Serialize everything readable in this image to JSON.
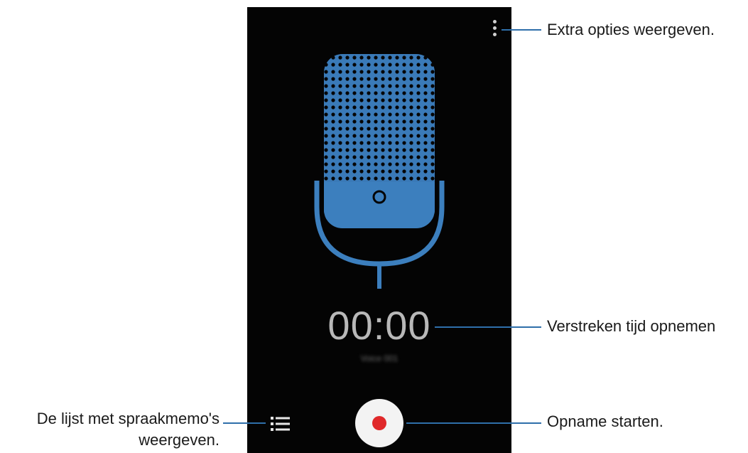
{
  "colors": {
    "screen_background": "#040404",
    "accent_blue": "#3c7fbe",
    "callout_line": "#2f6faa",
    "record_red": "#e0282a"
  },
  "icons": {
    "menu": "more-options-icon",
    "microphone": "microphone-icon",
    "list": "list-icon",
    "record": "record-icon"
  },
  "recorder": {
    "elapsed_time": "00:00",
    "sub_label": "Voice 001"
  },
  "callouts": {
    "more_options": "Extra opties weergeven.",
    "elapsed_time": "Verstreken tijd opnemen",
    "start_recording": "Opname starten.",
    "memo_list_line1": "De lijst met spraakmemo's",
    "memo_list_line2": "weergeven."
  }
}
